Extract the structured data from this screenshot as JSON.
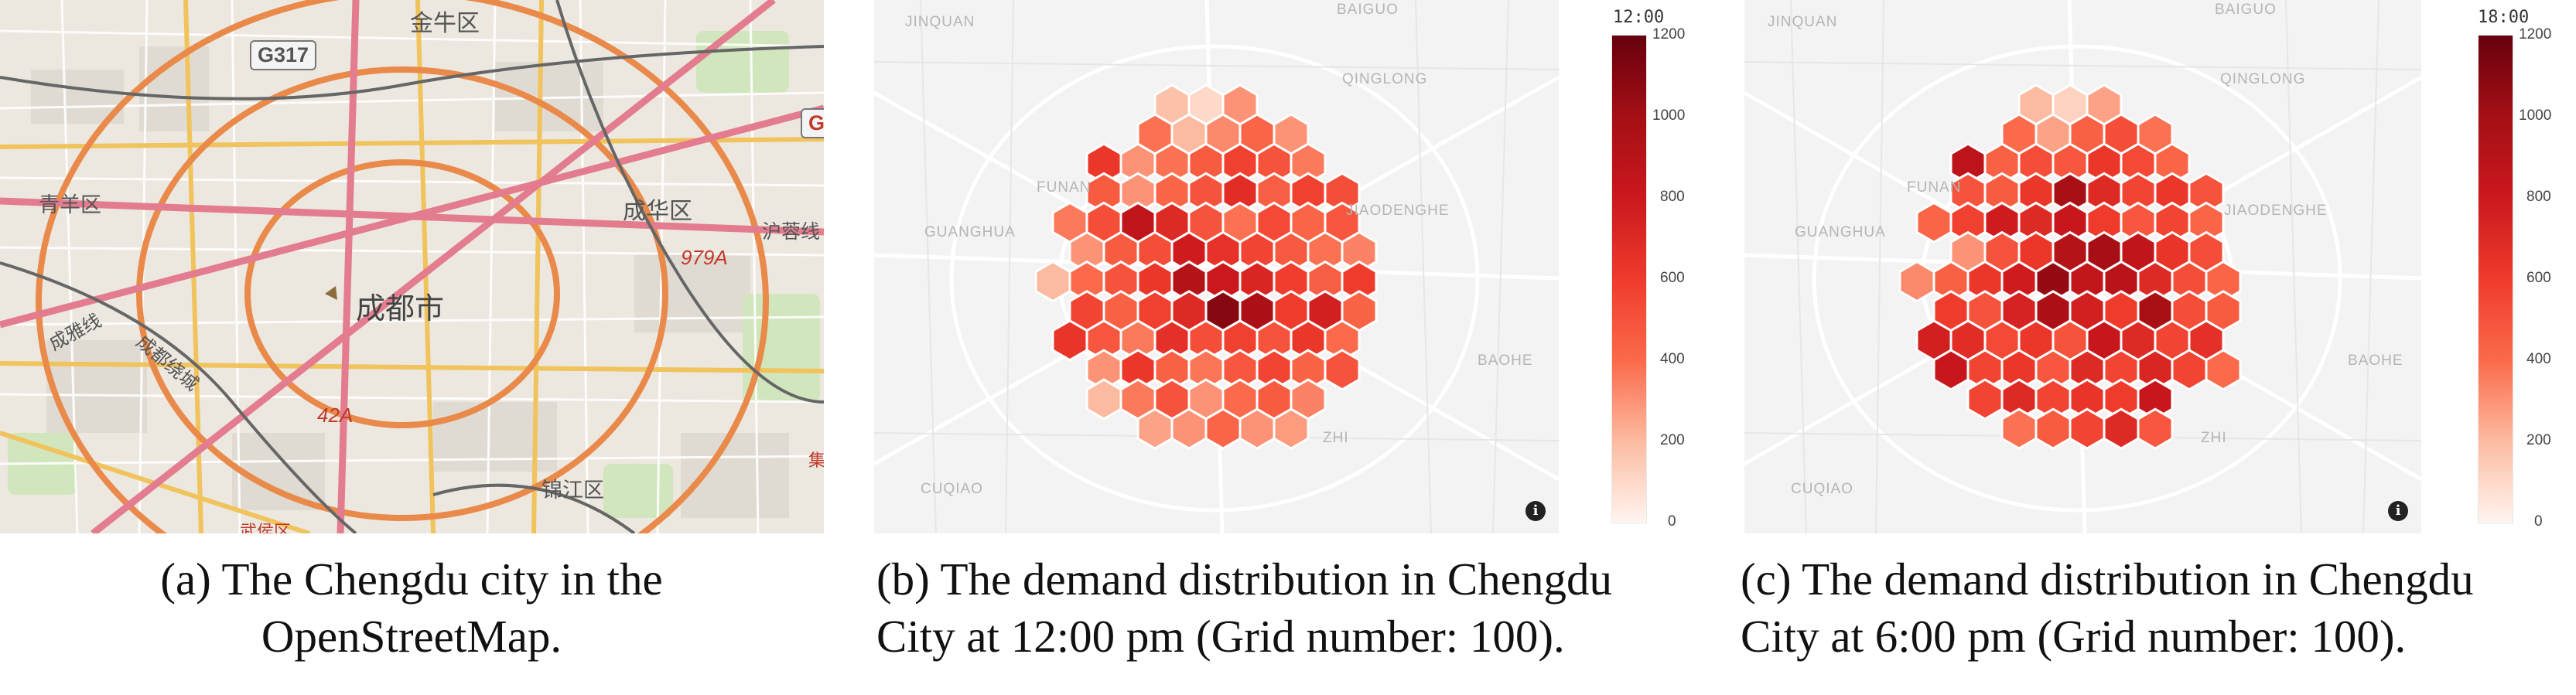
{
  "panel_a": {
    "map_labels": {
      "jinniu": "金牛区",
      "g317": "G317",
      "g_edge": "G",
      "qingyang": "青羊区",
      "chenghua": "成华区",
      "hongshan": "沪蓉线",
      "city": "成都市",
      "route_979a": "979A",
      "chengya": "成雅线",
      "ring": "成都绕城",
      "route_42a": "42A",
      "jinjiang": "锦江区",
      "wuhou": "武侯区",
      "edge": "集"
    },
    "caption_line1": "(a) The Chengdu city in the",
    "caption_line2": "OpenStreetMap."
  },
  "panel_b": {
    "map_labels": [
      "JINQUAN",
      "QINGLONG",
      "FUNAN",
      "JIAODENGHE",
      "GUANGHUA",
      "BAOHE",
      "CUQIAO",
      "BAIGUO",
      "ZHI"
    ],
    "colorbar_title": "12:00",
    "caption_line1": "(b) The demand distribution in Chengdu",
    "caption_line2": "City at 12:00 pm (Grid number: 100)."
  },
  "panel_c": {
    "map_labels": [
      "JINQUAN",
      "QINGLONG",
      "FUNAN",
      "JIAODENGHE",
      "GUANGHUA",
      "BAOHE",
      "CUQIAO",
      "BAIGUO",
      "ZHI"
    ],
    "colorbar_title": "18:00",
    "caption_line1": "(c) The demand distribution in Chengdu",
    "caption_line2": "City at 6:00 pm (Grid number: 100)."
  },
  "colorbar": {
    "ticks": [
      "1200",
      "1000",
      "800",
      "600",
      "400",
      "200",
      "0"
    ],
    "range": [
      0,
      1200
    ],
    "colors": [
      "#fff5f0",
      "#fcbba1",
      "#fb6a4a",
      "#ef3b2c",
      "#cb181d",
      "#a50f15",
      "#67000d"
    ]
  },
  "info_icon": "i",
  "chart_data": [
    {
      "type": "heatmap",
      "title": "12:00",
      "grid": "hexagonal",
      "cells": 100,
      "value_range": [
        0,
        1200
      ],
      "rows": [
        [
          180,
          100,
          300
        ],
        [
          380,
          200,
          320,
          420,
          300
        ],
        [
          620,
          300,
          380,
          460,
          580,
          500,
          360
        ],
        [
          460,
          300,
          420,
          500,
          680,
          450,
          580,
          520
        ],
        [
          360,
          520,
          860,
          700,
          500,
          380,
          540,
          420,
          480
        ],
        [
          300,
          460,
          520,
          780,
          650,
          560,
          470,
          380,
          340
        ],
        [
          200,
          400,
          500,
          620,
          920,
          800,
          720,
          590,
          450,
          600
        ],
        [
          560,
          440,
          580,
          700,
          1100,
          960,
          600,
          760,
          430
        ],
        [
          640,
          480,
          360,
          660,
          520,
          580,
          500,
          620,
          400
        ],
        [
          300,
          620,
          440,
          370,
          480,
          560,
          430,
          500
        ],
        [
          200,
          360,
          500,
          300,
          400,
          460,
          340
        ],
        [
          260,
          300,
          420,
          300,
          280
        ]
      ]
    },
    {
      "type": "heatmap",
      "title": "18:00",
      "grid": "hexagonal",
      "cells": 100,
      "value_range": [
        0,
        1200
      ],
      "rows": [
        [
          200,
          120,
          260
        ],
        [
          400,
          260,
          440,
          520,
          380
        ],
        [
          880,
          440,
          520,
          480,
          620,
          540,
          420
        ],
        [
          500,
          460,
          620,
          980,
          700,
          560,
          620,
          500
        ],
        [
          420,
          580,
          780,
          700,
          820,
          600,
          480,
          560,
          420
        ],
        [
          300,
          500,
          620,
          920,
          1000,
          860,
          640,
          520
        ],
        [
          320,
          440,
          620,
          780,
          1050,
          840,
          900,
          700,
          520,
          420
        ],
        [
          600,
          500,
          740,
          960,
          760,
          600,
          980,
          520,
          460
        ],
        [
          760,
          680,
          540,
          620,
          500,
          820,
          700,
          560,
          660
        ],
        [
          820,
          560,
          620,
          480,
          700,
          560,
          720,
          560,
          400
        ],
        [
          560,
          700,
          560,
          640,
          600,
          820
        ],
        [
          380,
          460,
          560,
          700,
          480
        ]
      ]
    }
  ]
}
